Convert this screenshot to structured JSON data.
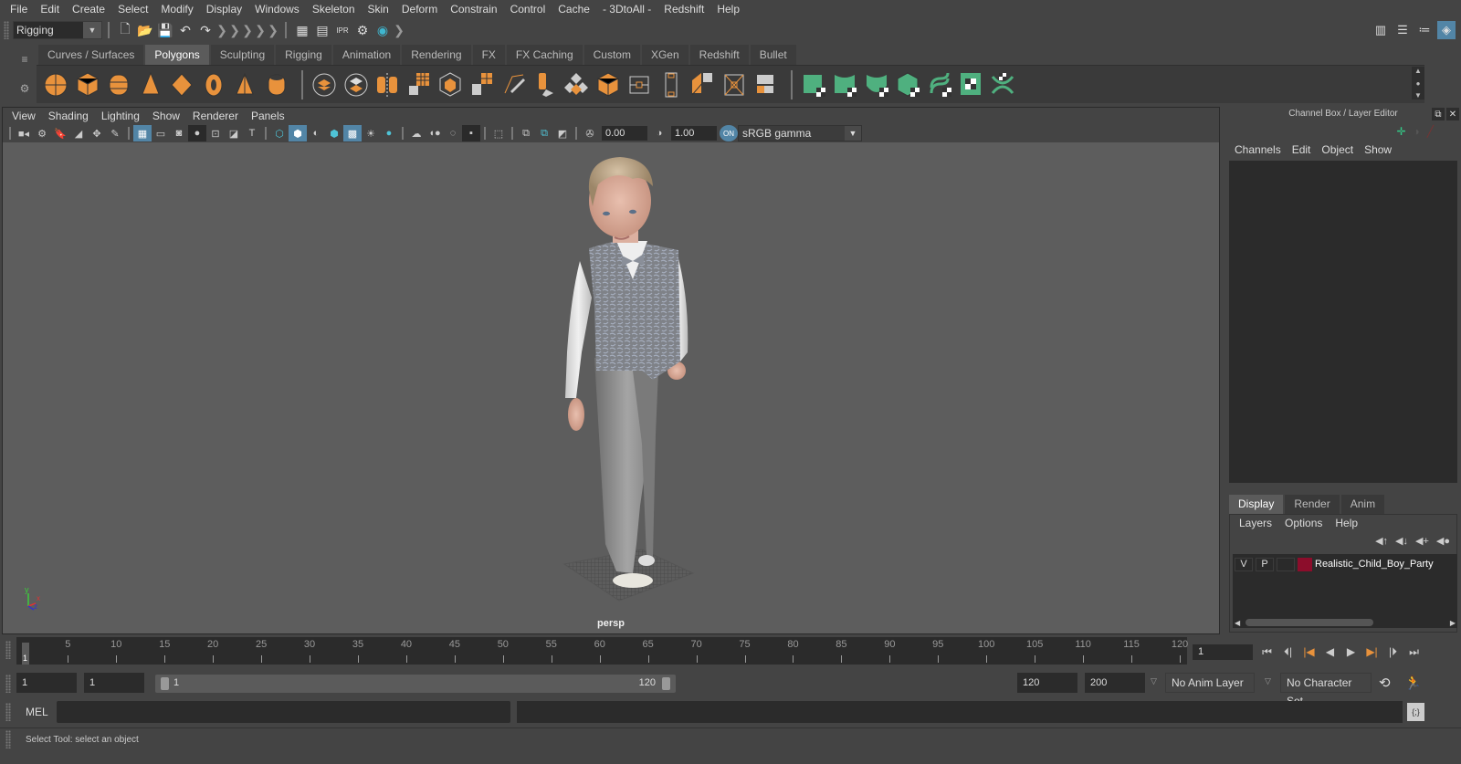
{
  "menubar": [
    "File",
    "Edit",
    "Create",
    "Select",
    "Modify",
    "Display",
    "Windows",
    "Skeleton",
    "Skin",
    "Deform",
    "Constrain",
    "Control",
    "Cache",
    "- 3DtoAll -",
    "Redshift",
    "Help"
  ],
  "statusline": {
    "mode": "Rigging"
  },
  "shelf": {
    "tabs": [
      "Curves / Surfaces",
      "Polygons",
      "Sculpting",
      "Rigging",
      "Animation",
      "Rendering",
      "FX",
      "FX Caching",
      "Custom",
      "XGen",
      "Redshift",
      "Bullet"
    ],
    "active_tab": "Polygons",
    "icon_color_orange": "#e8923c",
    "icon_color_green": "#4fb07f"
  },
  "panel": {
    "menu": [
      "View",
      "Shading",
      "Lighting",
      "Show",
      "Renderer",
      "Panels"
    ],
    "exposure": "0.00",
    "gamma": "1.00",
    "color_space": "sRGB gamma",
    "camera_label": "persp"
  },
  "axis": {
    "y": "y",
    "x": "x",
    "z": "z"
  },
  "channel_box": {
    "title": "Channel Box / Layer Editor",
    "menu": [
      "Channels",
      "Edit",
      "Object",
      "Show"
    ]
  },
  "layer_editor": {
    "tabs": [
      "Display",
      "Render",
      "Anim"
    ],
    "active_tab": "Display",
    "menu": [
      "Layers",
      "Options",
      "Help"
    ],
    "layers": [
      {
        "v": "V",
        "p": "P",
        "name": "Realistic_Child_Boy_Party",
        "color": "#8c0d2b"
      }
    ]
  },
  "timeline": {
    "ticks": [
      5,
      10,
      15,
      20,
      25,
      30,
      35,
      40,
      45,
      50,
      55,
      60,
      65,
      70,
      75,
      80,
      85,
      90,
      95,
      100,
      105,
      110,
      115,
      120
    ],
    "start_marker": "1",
    "current_frame": "1"
  },
  "range": {
    "start": "1",
    "anim_start": "1",
    "slider_start": "1",
    "slider_end": "120",
    "end": "120",
    "anim_end": "200",
    "anim_layer": "No Anim Layer",
    "character_set": "No Character Set"
  },
  "command_line": {
    "label": "MEL"
  },
  "help_line": {
    "text": "Select Tool: select an object"
  }
}
